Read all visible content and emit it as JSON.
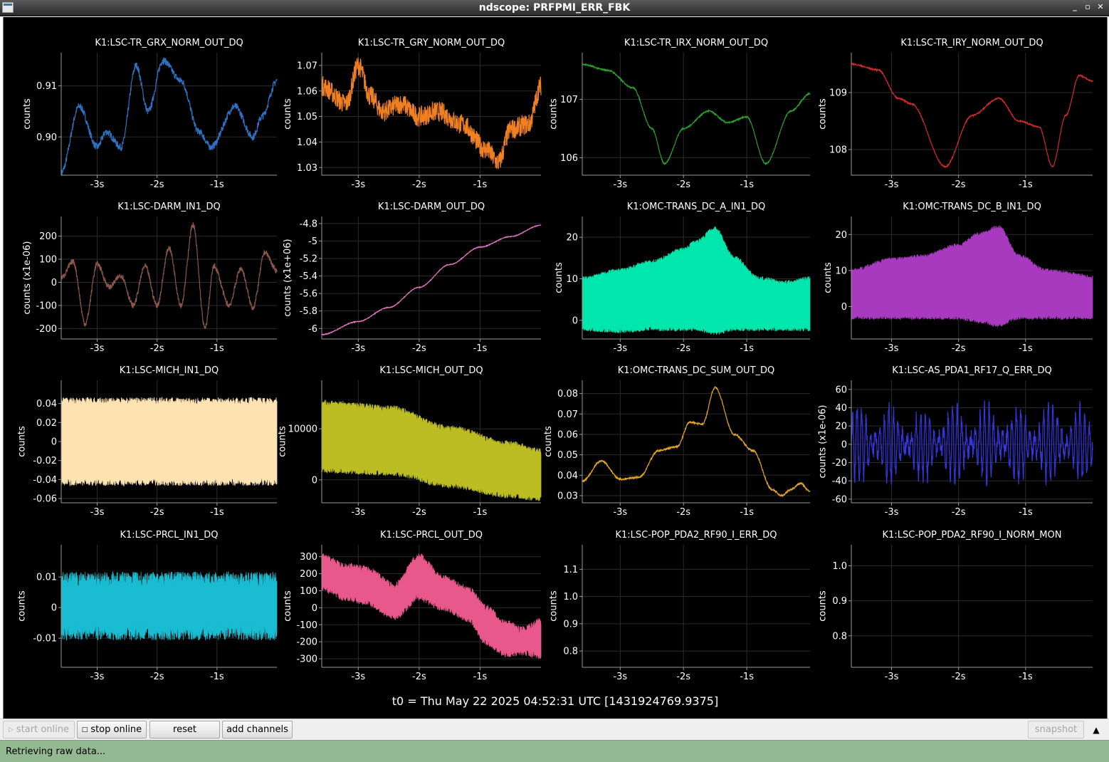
{
  "window": {
    "title": "ndscope: PRFPMI_ERR_FBK",
    "controls": [
      "_",
      "▫",
      "✕"
    ]
  },
  "colors": {
    "background": "#000000",
    "grid": "#2b2b2b",
    "axis": "#9a9a9a",
    "text": "#ffffff",
    "status_bar": "#93b993"
  },
  "t0_label": "t0 = Thu May 22 2025 04:52:31 UTC [1431924769.9375]",
  "toolbar": {
    "start_online": "start online",
    "stop_online": "stop online",
    "reset": "reset",
    "add_channels": "add channels",
    "snapshot": "snapshot"
  },
  "status": {
    "text": "Retrieving raw data..."
  },
  "chart_data": [
    {
      "type": "line",
      "title": "K1:LSC-TR_GRX_NORM_OUT_DQ",
      "ylabel": "counts",
      "color": "#2f72c4",
      "xlim": [
        -3.6,
        0
      ],
      "ylim": [
        0.8925,
        0.9165
      ],
      "yticks": [
        0.9,
        0.91
      ],
      "ytick_labels": [
        "0.90",
        "0.91"
      ],
      "xticks": [
        -3,
        -2,
        -1
      ],
      "xtick_labels": [
        "-3s",
        "-2s",
        "-1s"
      ],
      "style": "line",
      "noise": 0.0007,
      "x": [
        -3.6,
        -3.3,
        -3.0,
        -2.85,
        -2.6,
        -2.35,
        -2.15,
        -1.9,
        -1.6,
        -1.3,
        -1.1,
        -0.7,
        -0.4,
        -0.25,
        0
      ],
      "y": [
        0.893,
        0.906,
        0.898,
        0.901,
        0.898,
        0.914,
        0.905,
        0.915,
        0.911,
        0.901,
        0.898,
        0.906,
        0.9,
        0.904,
        0.911
      ]
    },
    {
      "type": "line",
      "title": "K1:LSC-TR_GRY_NORM_OUT_DQ",
      "ylabel": "counts",
      "color": "#f08021",
      "xlim": [
        -3.6,
        0
      ],
      "ylim": [
        1.027,
        1.075
      ],
      "yticks": [
        1.03,
        1.04,
        1.05,
        1.06,
        1.07
      ],
      "ytick_labels": [
        "1.03",
        "1.04",
        "1.05",
        "1.06",
        "1.07"
      ],
      "xticks": [
        -3,
        -2,
        -1
      ],
      "xtick_labels": [
        "-3s",
        "-2s",
        "-1s"
      ],
      "style": "line",
      "noise": 0.004,
      "x": [
        -3.6,
        -3.2,
        -3.0,
        -2.8,
        -2.6,
        -2.3,
        -2.0,
        -1.7,
        -1.3,
        -0.9,
        -0.7,
        -0.5,
        -0.2,
        0
      ],
      "y": [
        1.062,
        1.055,
        1.07,
        1.058,
        1.052,
        1.055,
        1.05,
        1.052,
        1.047,
        1.037,
        1.032,
        1.045,
        1.047,
        1.062
      ]
    },
    {
      "type": "line",
      "title": "K1:LSC-TR_IRX_NORM_OUT_DQ",
      "ylabel": "counts",
      "color": "#2e9e2e",
      "xlim": [
        -3.6,
        0
      ],
      "ylim": [
        105.7,
        107.8
      ],
      "yticks": [
        106,
        107
      ],
      "ytick_labels": [
        "106",
        "107"
      ],
      "xticks": [
        -3,
        -2,
        -1
      ],
      "xtick_labels": [
        "-3s",
        "-2s",
        "-1s"
      ],
      "style": "line",
      "noise": 0.012,
      "x": [
        -3.6,
        -3.2,
        -2.8,
        -2.5,
        -2.3,
        -2.0,
        -1.6,
        -1.3,
        -1.0,
        -0.7,
        -0.3,
        0
      ],
      "y": [
        107.6,
        107.5,
        107.2,
        106.5,
        105.9,
        106.5,
        106.8,
        106.6,
        106.7,
        105.9,
        106.8,
        107.1
      ]
    },
    {
      "type": "line",
      "title": "K1:LSC-TR_IRY_NORM_OUT_DQ",
      "ylabel": "counts",
      "color": "#d42a2a",
      "xlim": [
        -3.6,
        0
      ],
      "ylim": [
        107.55,
        109.7
      ],
      "yticks": [
        108,
        109
      ],
      "ytick_labels": [
        "108",
        "109"
      ],
      "xticks": [
        -3,
        -2,
        -1
      ],
      "xtick_labels": [
        "-3s",
        "-2s",
        "-1s"
      ],
      "style": "line",
      "noise": 0.012,
      "x": [
        -3.6,
        -3.2,
        -2.9,
        -2.7,
        -2.2,
        -1.8,
        -1.4,
        -1.1,
        -0.8,
        -0.6,
        -0.4,
        -0.2,
        0
      ],
      "y": [
        109.5,
        109.4,
        108.9,
        108.8,
        107.7,
        108.6,
        108.9,
        108.5,
        108.4,
        107.7,
        108.6,
        109.3,
        109.2
      ]
    },
    {
      "type": "line",
      "title": "K1:LSC-DARM_IN1_DQ",
      "ylabel": "counts (x1e-06)",
      "color": "#8c564b",
      "xlim": [
        -3.6,
        0
      ],
      "ylim": [
        -245,
        285
      ],
      "yticks": [
        -200,
        -100,
        0,
        100,
        200
      ],
      "ytick_labels": [
        "-200",
        "-100",
        "0",
        "100",
        "200"
      ],
      "xticks": [
        -3,
        -2,
        -1
      ],
      "xtick_labels": [
        "-3s",
        "-2s",
        "-1s"
      ],
      "style": "line",
      "noise": 12,
      "x": [
        -3.6,
        -3.4,
        -3.2,
        -3.0,
        -2.8,
        -2.6,
        -2.4,
        -2.2,
        -2.0,
        -1.8,
        -1.6,
        -1.4,
        -1.2,
        -1.05,
        -0.8,
        -0.6,
        -0.4,
        -0.2,
        0
      ],
      "y": [
        20,
        90,
        -180,
        80,
        -20,
        30,
        -100,
        70,
        -100,
        150,
        -100,
        250,
        -200,
        70,
        -100,
        60,
        -110,
        130,
        50
      ]
    },
    {
      "type": "line",
      "title": "K1:LSC-DARM_OUT_DQ",
      "ylabel": "counts (x1e+06)",
      "color": "#e377c2",
      "xlim": [
        -3.6,
        0
      ],
      "ylim": [
        -6.12,
        -4.72
      ],
      "yticks": [
        -6,
        -5.8,
        -5.6,
        -5.4,
        -5.2,
        -5,
        -4.8
      ],
      "ytick_labels": [
        "-6",
        "-5.8",
        "-5.6",
        "-5.4",
        "-5.2",
        "-5",
        "-4.8"
      ],
      "xticks": [
        -3,
        -2,
        -1
      ],
      "xtick_labels": [
        "-3s",
        "-2s",
        "-1s"
      ],
      "style": "line",
      "noise": 0.004,
      "x": [
        -3.6,
        -3.0,
        -2.5,
        -2.0,
        -1.5,
        -1.0,
        -0.5,
        0
      ],
      "y": [
        -6.07,
        -5.92,
        -5.76,
        -5.53,
        -5.27,
        -5.07,
        -4.95,
        -4.82
      ]
    },
    {
      "type": "area",
      "title": "K1:OMC-TRANS_DC_A_IN1_DQ",
      "ylabel": "counts",
      "color": "#00e6ad",
      "xlim": [
        -3.6,
        0
      ],
      "ylim": [
        -4.5,
        25
      ],
      "yticks": [
        0,
        10,
        20
      ],
      "ytick_labels": [
        "0",
        "10",
        "20"
      ],
      "xticks": [
        -3,
        -2,
        -1
      ],
      "xtick_labels": [
        "-3s",
        "-2s",
        "-1s"
      ],
      "style": "band",
      "noise": 0.4,
      "x": [
        -3.6,
        -3.0,
        -2.5,
        -2.0,
        -1.8,
        -1.5,
        -1.2,
        -0.8,
        -0.4,
        0
      ],
      "y_upper": [
        10,
        12,
        14,
        17,
        19,
        22,
        15,
        10,
        9,
        10
      ],
      "y_lower": [
        -2,
        -2.5,
        -2,
        -2,
        -2,
        -3,
        -2,
        -2,
        -2,
        -2
      ]
    },
    {
      "type": "area",
      "title": "K1:OMC-TRANS_DC_B_IN1_DQ",
      "ylabel": "counts",
      "color": "#a83ac0",
      "xlim": [
        -3.6,
        0
      ],
      "ylim": [
        -9,
        25
      ],
      "yticks": [
        0,
        10,
        20
      ],
      "ytick_labels": [
        "0",
        "10",
        "20"
      ],
      "xticks": [
        -3,
        -2,
        -1
      ],
      "xtick_labels": [
        "-3s",
        "-2s",
        "-1s"
      ],
      "style": "band",
      "noise": 0.4,
      "x": [
        -3.6,
        -3.0,
        -2.5,
        -2.0,
        -1.7,
        -1.4,
        -1.1,
        -0.7,
        -0.3,
        0
      ],
      "y_upper": [
        10,
        13,
        14,
        17,
        20,
        22,
        14,
        10,
        9,
        8
      ],
      "y_lower": [
        -3,
        -3,
        -3,
        -3,
        -4,
        -5,
        -3,
        -3,
        -3,
        -3
      ]
    },
    {
      "type": "area",
      "title": "K1:LSC-MICH_IN1_DQ",
      "ylabel": "counts",
      "color": "#fde3b2",
      "xlim": [
        -3.6,
        0
      ],
      "ylim": [
        -0.0645,
        0.0645
      ],
      "yticks": [
        -0.06,
        -0.04,
        -0.02,
        0,
        0.02,
        0.04
      ],
      "ytick_labels": [
        "-0.06",
        "-0.04",
        "-0.02",
        "0",
        "0.02",
        "0.04"
      ],
      "xticks": [
        -3,
        -2,
        -1
      ],
      "xtick_labels": [
        "-3s",
        "-2s",
        "-1s"
      ],
      "style": "band",
      "noise": 0.003,
      "x": [
        -3.6,
        0
      ],
      "y_upper": [
        0.042,
        0.042
      ],
      "y_lower": [
        -0.042,
        -0.042
      ]
    },
    {
      "type": "area",
      "title": "K1:LSC-MICH_OUT_DQ",
      "ylabel": "counts",
      "color": "#bcbd22",
      "xlim": [
        -3.6,
        0
      ],
      "ylim": [
        -4500,
        19500
      ],
      "yticks": [
        0,
        10000
      ],
      "ytick_labels": [
        "0",
        "10000"
      ],
      "xticks": [
        -3,
        -2,
        -1
      ],
      "xtick_labels": [
        "-3s",
        "-2s",
        "-1s"
      ],
      "style": "band",
      "noise": 450,
      "x": [
        -3.6,
        -2.5,
        -1.5,
        -0.5,
        0
      ],
      "y_upper": [
        15000,
        14000,
        10000,
        7000,
        5500
      ],
      "y_lower": [
        2000,
        1500,
        -1000,
        -3000,
        -3500
      ]
    },
    {
      "type": "line",
      "title": "K1:OMC-TRANS_DC_SUM_OUT_DQ",
      "ylabel": "counts",
      "color": "#e3a628",
      "xlim": [
        -3.6,
        0
      ],
      "ylim": [
        0.0265,
        0.0865
      ],
      "yticks": [
        0.03,
        0.04,
        0.05,
        0.06,
        0.07,
        0.08
      ],
      "ytick_labels": [
        "0.03",
        "0.04",
        "0.05",
        "0.06",
        "0.07",
        "0.08"
      ],
      "xticks": [
        -3,
        -2,
        -1
      ],
      "xtick_labels": [
        "-3s",
        "-2s",
        "-1s"
      ],
      "style": "line",
      "noise": 0.0004,
      "x": [
        -3.6,
        -3.3,
        -3.0,
        -2.7,
        -2.4,
        -2.1,
        -1.9,
        -1.7,
        -1.5,
        -1.2,
        -0.9,
        -0.6,
        -0.45,
        -0.3,
        -0.15,
        0
      ],
      "y": [
        0.037,
        0.047,
        0.038,
        0.039,
        0.052,
        0.054,
        0.066,
        0.065,
        0.083,
        0.06,
        0.052,
        0.033,
        0.03,
        0.033,
        0.036,
        0.032
      ]
    },
    {
      "type": "line",
      "title": "K1:LSC-AS_PDA1_RF17_Q_ERR_DQ",
      "ylabel": "counts (x1e-06)",
      "color": "#3535e0",
      "xlim": [
        -3.6,
        0
      ],
      "ylim": [
        -64,
        70
      ],
      "yticks": [
        -60,
        -40,
        -20,
        0,
        20,
        40,
        60
      ],
      "ytick_labels": [
        "-60",
        "-40",
        "-20",
        "0",
        "20",
        "40",
        "60"
      ],
      "xticks": [
        -3,
        -2,
        -1
      ],
      "xtick_labels": [
        "-3s",
        "-2s",
        "-1s"
      ],
      "style": "osc",
      "noise": 10,
      "x": [
        -3.6,
        0
      ],
      "y": [
        0,
        0
      ],
      "amp": 40
    },
    {
      "type": "area",
      "title": "K1:LSC-PRCL_IN1_DQ",
      "ylabel": "counts",
      "color": "#19bcd0",
      "xlim": [
        -3.6,
        0
      ],
      "ylim": [
        -0.0195,
        0.0205
      ],
      "yticks": [
        -0.01,
        0,
        0.01
      ],
      "ytick_labels": [
        "-0.01",
        "0",
        "0.01"
      ],
      "xticks": [
        -3,
        -2,
        -1
      ],
      "xtick_labels": [
        "-3s",
        "-2s",
        "-1s"
      ],
      "style": "band",
      "noise": 0.0018,
      "x": [
        -3.6,
        0
      ],
      "y_upper": [
        0.009,
        0.009
      ],
      "y_lower": [
        -0.008,
        -0.008
      ]
    },
    {
      "type": "area",
      "title": "K1:LSC-PRCL_OUT_DQ",
      "ylabel": "counts",
      "color": "#e8588a",
      "xlim": [
        -3.6,
        0
      ],
      "ylim": [
        -350,
        370
      ],
      "yticks": [
        -300,
        -200,
        -100,
        0,
        100,
        200,
        300
      ],
      "ytick_labels": [
        "-300",
        "-200",
        "-100",
        "0",
        "100",
        "200",
        "300"
      ],
      "xticks": [
        -3,
        -2,
        -1
      ],
      "xtick_labels": [
        "-3s",
        "-2s",
        "-1s"
      ],
      "style": "band",
      "noise": 15,
      "x": [
        -3.6,
        -3.2,
        -2.9,
        -2.4,
        -2.0,
        -1.6,
        -1.2,
        -0.9,
        -0.6,
        -0.3,
        0
      ],
      "y_upper": [
        300,
        240,
        230,
        130,
        300,
        170,
        110,
        0,
        -90,
        -130,
        -80
      ],
      "y_lower": [
        120,
        60,
        40,
        -50,
        60,
        0,
        -60,
        -200,
        -270,
        -260,
        -280
      ]
    },
    {
      "type": "line",
      "title": "K1:LSC-POP_PDA2_RF90_I_ERR_DQ",
      "ylabel": "counts",
      "color": "#ffffff",
      "xlim": [
        -3.6,
        0
      ],
      "ylim": [
        0.74,
        1.19
      ],
      "yticks": [
        0.8,
        0.9,
        1.0,
        1.1
      ],
      "ytick_labels": [
        "0.8",
        "0.9",
        "1.0",
        "1.1"
      ],
      "xticks": [
        -3,
        -2,
        -1
      ],
      "xtick_labels": [
        "-3s",
        "-2s",
        "-1s"
      ],
      "style": "empty",
      "x": [],
      "y": []
    },
    {
      "type": "line",
      "title": "K1:LSC-POP_PDA2_RF90_I_NORM_MON",
      "ylabel": "counts",
      "color": "#ffffff",
      "xlim": [
        -3.6,
        0
      ],
      "ylim": [
        0.71,
        1.06
      ],
      "yticks": [
        0.8,
        0.9,
        1.0
      ],
      "ytick_labels": [
        "0.8",
        "0.9",
        "1.0"
      ],
      "xticks": [
        -3,
        -2,
        -1
      ],
      "xtick_labels": [
        "-3s",
        "-2s",
        "-1s"
      ],
      "style": "empty",
      "x": [],
      "y": []
    }
  ]
}
